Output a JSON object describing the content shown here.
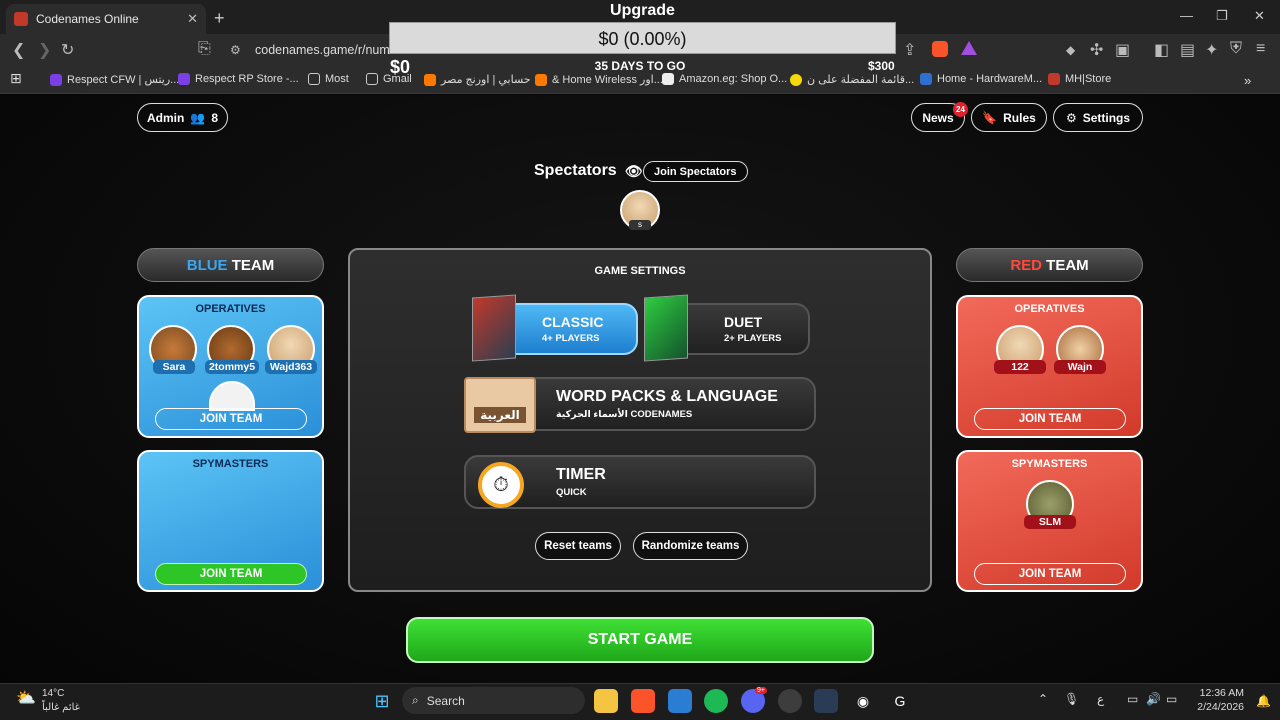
{
  "browser": {
    "tab_title": "Codenames Online",
    "url": "codenames.game/r/numo",
    "bookmarks": [
      {
        "label": "Respect CFW | ريتس...",
        "color": "#7b3fe4"
      },
      {
        "label": "Respect RP Store -...",
        "color": "#7b3fe4"
      },
      {
        "label": "Most",
        "color": "#888"
      },
      {
        "label": "Gmail",
        "color": "#888"
      },
      {
        "label": "حسابي | اورنج مصر",
        "color": "#ff7900"
      },
      {
        "label": "& Home Wireless اور...",
        "color": "#ff7900"
      },
      {
        "label": "Amazon.eg: Shop O...",
        "color": "#eee"
      },
      {
        "label": "قائمة المفضلة على ن...",
        "color": "#f5d90a"
      },
      {
        "label": "Home - HardwareM...",
        "color": "#2f6fd1"
      },
      {
        "label": "MH|Store",
        "color": "#c0392b"
      }
    ]
  },
  "upgrade": {
    "title": "Upgrade",
    "bar_text": "$0 (0.00%)",
    "left": "$0",
    "mid": "35 DAYS TO GO",
    "right": "$300"
  },
  "header": {
    "admin_label": "Admin",
    "player_count": "8",
    "news_label": "News",
    "news_badge": "24",
    "rules_label": "Rules",
    "settings_label": "Settings"
  },
  "spectators": {
    "title": "Spectators",
    "join_label": "Join Spectators",
    "spectator_name": "s"
  },
  "blue_team": {
    "title_word": "BLUE",
    "title_rest": " TEAM",
    "operatives_label": "OPERATIVES",
    "operatives": [
      "Sara",
      "2tommy5",
      "Wajd363"
    ],
    "join_label": "JOIN TEAM",
    "spymasters_label": "SPYMASTERS",
    "spy_join_label": "JOIN TEAM"
  },
  "red_team": {
    "title_word": "RED",
    "title_rest": " TEAM",
    "operatives_label": "OPERATIVES",
    "operatives": [
      "122",
      "Wajn"
    ],
    "join_label": "JOIN TEAM",
    "spymasters_label": "SPYMASTERS",
    "spymasters": [
      "SLM"
    ],
    "spy_join_label": "JOIN TEAM"
  },
  "game_settings": {
    "title": "GAME SETTINGS",
    "classic_label": "CLASSIC",
    "classic_sub": "4+ PLAYERS",
    "duet_label": "DUET",
    "duet_sub": "2+ PLAYERS",
    "word_packs_label": "WORD PACKS & LANGUAGE",
    "word_packs_sub": "الأسماء الحركية CODENAMES",
    "language_card": "العربية",
    "timer_label": "TIMER",
    "timer_sub": "QUICK",
    "reset_label": "Reset teams",
    "randomize_label": "Randomize teams"
  },
  "start_label": "START GAME",
  "taskbar": {
    "weather_temp": "14°C",
    "weather_desc": "غائم غالباً",
    "search_label": "Search",
    "discord_badge": "9+",
    "time": "12:36 AM",
    "date": "2/24/2026",
    "lang": "ع"
  },
  "colors": {
    "blue_accent": "#3aa7f0",
    "red_accent": "#e53a2c",
    "green": "#2ec627"
  }
}
